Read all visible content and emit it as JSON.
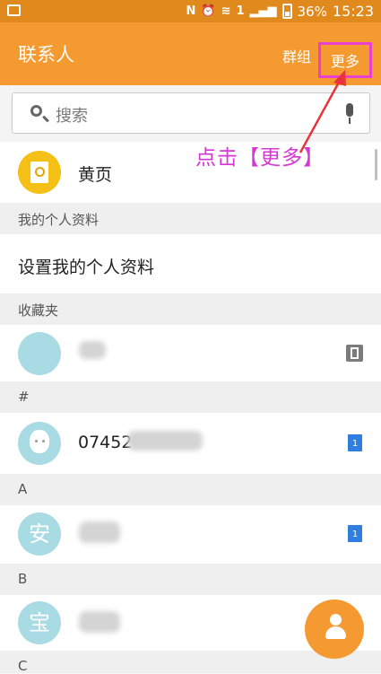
{
  "status_bar": {
    "battery_percent": "36%",
    "time": "15:23",
    "icons": [
      "image-icon",
      "nfc-icon",
      "alarm-icon",
      "wifi-icon",
      "sim1-icon",
      "signal-3g-icon",
      "battery-icon"
    ],
    "network_label": "1",
    "nfc_label": "N"
  },
  "app_bar": {
    "title": "联系人",
    "groups_label": "群组",
    "more_label": "更多"
  },
  "search": {
    "placeholder": "搜索"
  },
  "annotation": {
    "text": "点击【更多】",
    "color": "#d636d6"
  },
  "list": {
    "yellow_pages_label": "黄页",
    "sections": {
      "my_profile": "我的个人资料",
      "favorites": "收藏夹",
      "hash": "#",
      "a": "A",
      "b": "B",
      "c": "C"
    },
    "setup_profile_label": "设置我的个人资料",
    "contacts": [
      {
        "avatar_char": "",
        "name": "",
        "storage_icon": "phone-storage-icon"
      },
      {
        "avatar_char": "",
        "name": "07452",
        "storage_icon": "sim1-card-icon"
      },
      {
        "avatar_char": "安",
        "name": "",
        "storage_icon": "sim1-card-icon"
      },
      {
        "avatar_char": "宝",
        "name": "",
        "storage_icon": "sim1-card-icon"
      }
    ],
    "sim_badge": "1"
  },
  "colors": {
    "accent": "#f59a30",
    "status_bar": "#e08a1d",
    "highlight_box": "#ea3fd2"
  }
}
